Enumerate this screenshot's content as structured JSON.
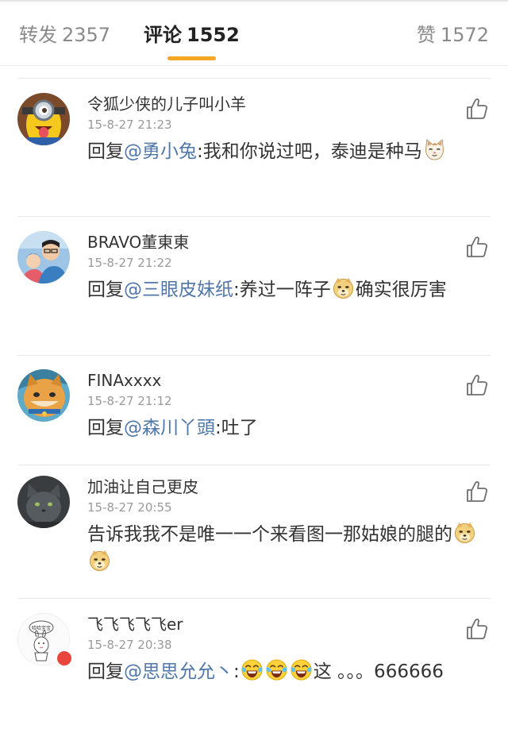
{
  "tabs": {
    "repost": {
      "label": "转发",
      "count": "2357"
    },
    "comments": {
      "label": "评论",
      "count": "1552"
    },
    "likes": {
      "label": "赞",
      "count": "1572"
    }
  },
  "comments": [
    {
      "username": "令狐少侠的儿子叫小羊",
      "time": "15-8-27 21:23",
      "reply_prefix": "回复",
      "mention": "@勇小兔",
      "text": ":我和你说过吧，泰迪是种马"
    },
    {
      "username": "BRAVO董東東",
      "time": "15-8-27 21:22",
      "reply_prefix": "回复",
      "mention": "@三眼皮妹纸",
      "text_before": ":养过一阵子",
      "text_after": "确实很厉害"
    },
    {
      "username": "FINAxxxx",
      "time": "15-8-27 21:12",
      "reply_prefix": "回复",
      "mention": "@森川丫頭",
      "text": ":吐了"
    },
    {
      "username": "加油让自己更皮",
      "time": "15-8-27 20:55",
      "text": "告诉我我不是唯一一个来看图一那姑娘的腿的"
    },
    {
      "username": "飞飞飞飞飞er",
      "time": "15-8-27 20:38",
      "reply_prefix": "回复",
      "mention": "@思思允允丶",
      "text_before": ":",
      "text_after": "这 。。。666666",
      "avatar_text": "哈哈宝宝"
    }
  ],
  "icons": {
    "like": "thumbs-up-icon",
    "emoji_cat": "cat-emoji-icon",
    "emoji_doge": "doge-emoji-icon",
    "emoji_laugh": "laughing-tears-emoji-icon"
  },
  "colors": {
    "accent": "#f5a623",
    "mention": "#4f77aa",
    "muted": "#9a9a9a",
    "text": "#333333"
  }
}
